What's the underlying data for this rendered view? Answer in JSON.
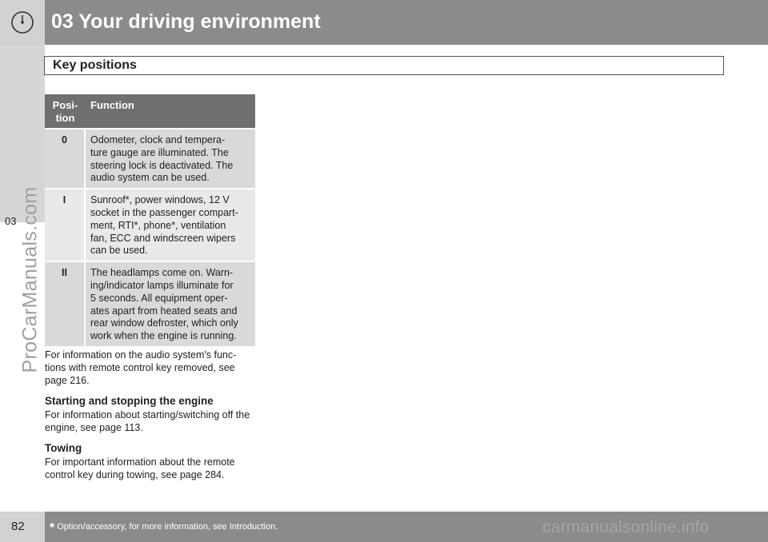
{
  "header": {
    "chapter_title": "03 Your driving environment",
    "icon": "gauge-icon"
  },
  "sidetab": {
    "label": "03"
  },
  "watermark": {
    "side": "ProCarManuals.com",
    "footer": "carmanualsonline.info"
  },
  "section": {
    "title": "Key positions"
  },
  "table": {
    "headers": [
      "Posi-\ntion",
      "Function"
    ],
    "rows": [
      {
        "pos": "0",
        "text": "Odometer, clock and tempera-\nture gauge are illuminated. The\nsteering lock is deactivated. The\naudio system can be used."
      },
      {
        "pos": "I",
        "text": "Sunroof*, power windows, 12 V\nsocket in the passenger compart-\nment, RTI*, phone*, ventilation\nfan, ECC and windscreen wipers\ncan be used."
      },
      {
        "pos": "II",
        "text": "The headlamps come on. Warn-\ning/indicator lamps illuminate for\n5 seconds. All equipment oper-\nates apart from heated seats and\nrear window defroster, which only\nwork when the engine is running."
      }
    ]
  },
  "body": {
    "audio_note": "For information on the audio system's func-\ntions with remote control key removed, see\npage 216.",
    "starting_heading": "Starting and stopping the engine",
    "starting_text": "For information about starting/switching off the\nengine, see page 113.",
    "towing_heading": "Towing",
    "towing_text": "For important information about the remote\ncontrol key during towing, see page 284."
  },
  "footer": {
    "page_number": "82",
    "footnote_star": "*",
    "footnote": "Option/accessory, for more information, see Introduction."
  }
}
